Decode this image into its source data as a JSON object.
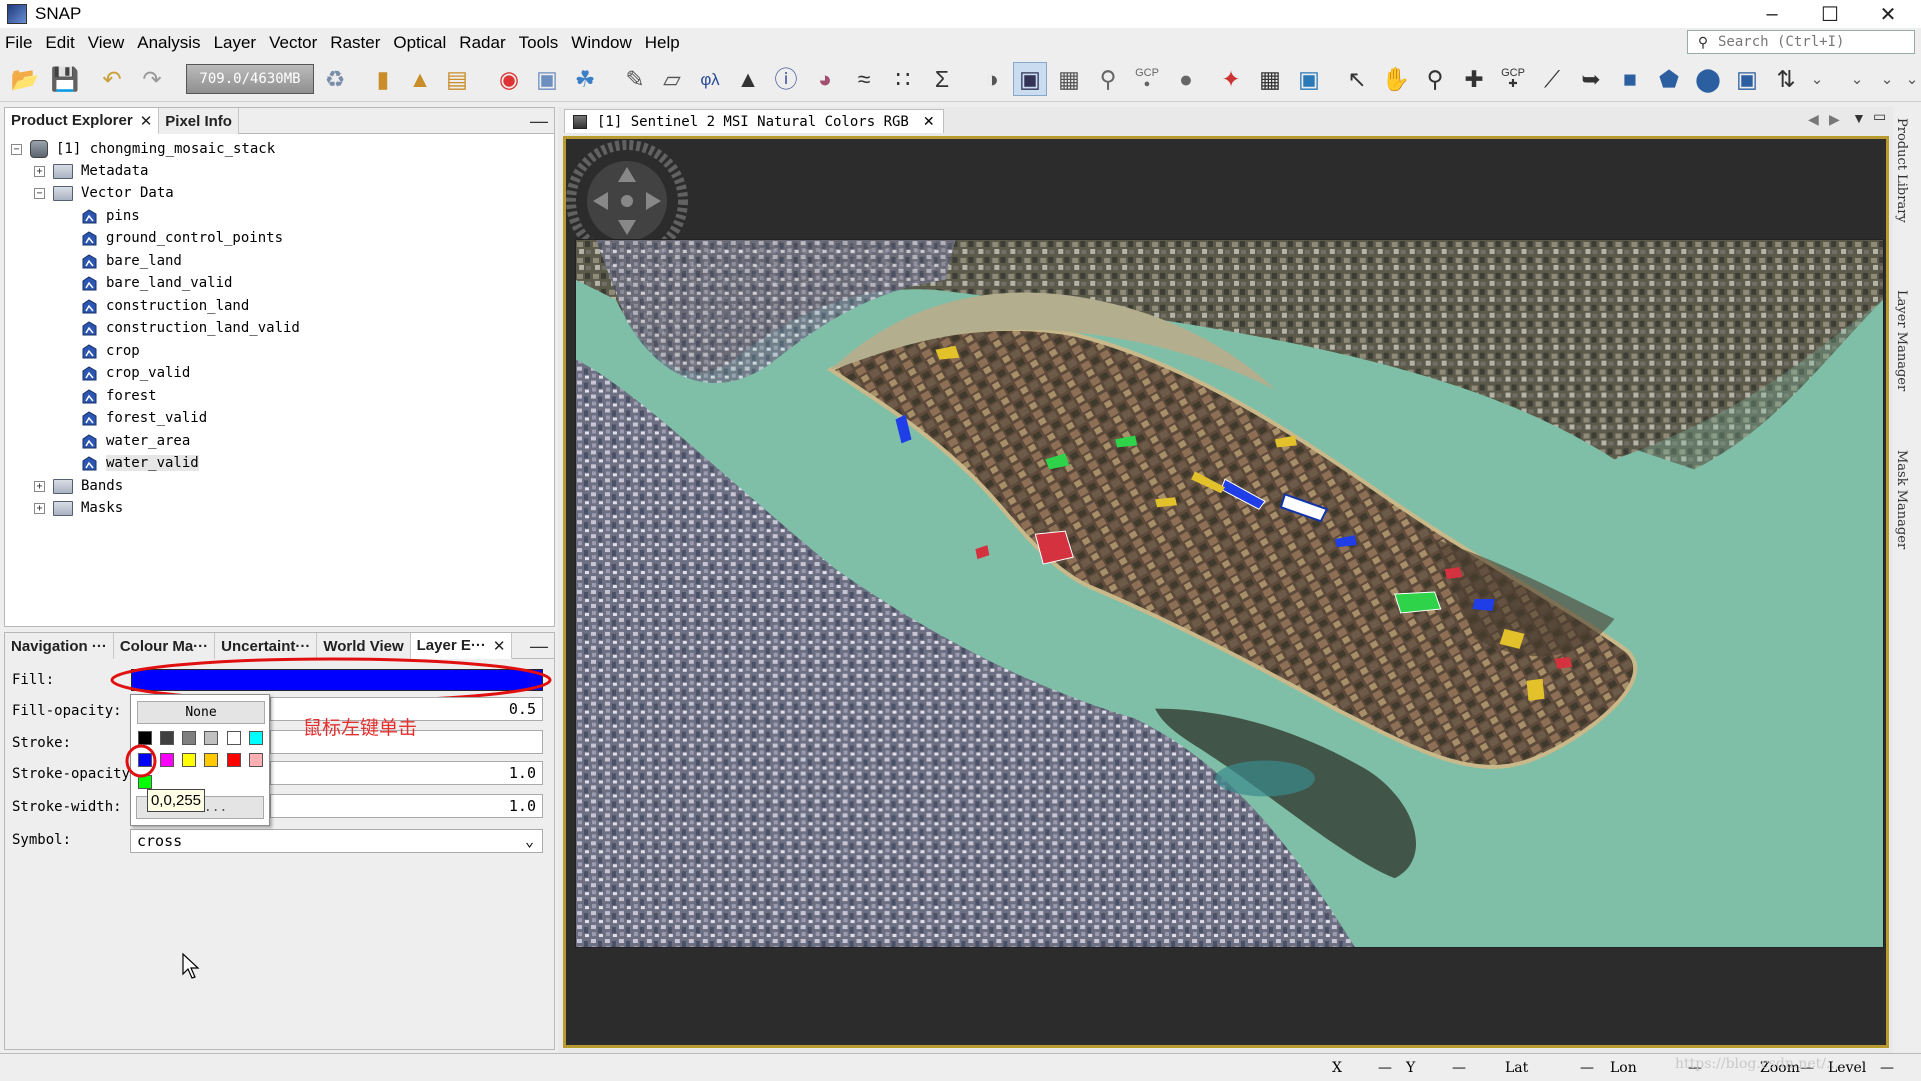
{
  "window": {
    "title": "SNAP"
  },
  "menu": [
    "File",
    "Edit",
    "View",
    "Analysis",
    "Layer",
    "Vector",
    "Raster",
    "Optical",
    "Radar",
    "Tools",
    "Window",
    "Help"
  ],
  "search": {
    "placeholder": "Search (Ctrl+I)"
  },
  "toolbar": {
    "memory": "709.0/4630MB",
    "gcp_label": "GCP"
  },
  "product_explorer": {
    "tabs": [
      "Product Explorer",
      "Pixel Info"
    ],
    "product": "[1] chongming_mosaic_stack",
    "nodes": {
      "metadata": "Metadata",
      "vector_data": "Vector Data",
      "vectors": [
        "pins",
        "ground_control_points",
        "bare_land",
        "bare_land_valid",
        "construction_land",
        "construction_land_valid",
        "crop",
        "crop_valid",
        "forest",
        "forest_valid",
        "water_area",
        "water_valid"
      ],
      "bands": "Bands",
      "masks": "Masks"
    },
    "selected": "water_valid"
  },
  "bottom_panel": {
    "tabs": [
      "Navigation ···",
      "Colour Ma···",
      "Uncertaint···",
      "World View",
      "Layer E···"
    ],
    "labels": {
      "fill": "Fill:",
      "fill_opacity": "Fill-opacity:",
      "stroke": "Stroke:",
      "stroke_opacity": "Stroke-opacity:",
      "stroke_width": "Stroke-width:",
      "symbol": "Symbol:"
    },
    "fill_color": "#0000ff",
    "fill_opacity": "0.5",
    "stroke_opacity": "1.0",
    "stroke_width": "1.0",
    "symbol": "cross"
  },
  "palette": {
    "none_label": "None",
    "more_label": "More...",
    "tooltip": "0,0,255",
    "row1": [
      "#000000",
      "#404040",
      "#808080",
      "#c0c0c0",
      "#ffffff",
      "#00ffff"
    ],
    "row2": [
      "#0000ff",
      "#ff00ff",
      "#ffff00",
      "#ffc800",
      "#ff0000",
      "#ffafaf"
    ],
    "row3": [
      "#00ff00"
    ]
  },
  "annotation": {
    "text": "鼠标左键单击",
    "color": "#e53030"
  },
  "document": {
    "tab": "[1] Sentinel 2 MSI Natural Colors RGB"
  },
  "right_sidebar": [
    "Product Library",
    "Layer Manager",
    "Mask Manager"
  ],
  "status": {
    "x": "X",
    "y": "Y",
    "lat": "Lat",
    "lon": "Lon",
    "zoom": "Zoom",
    "level": "Level",
    "dash": "—"
  },
  "watermark": "https://blog.csdn.net/..."
}
